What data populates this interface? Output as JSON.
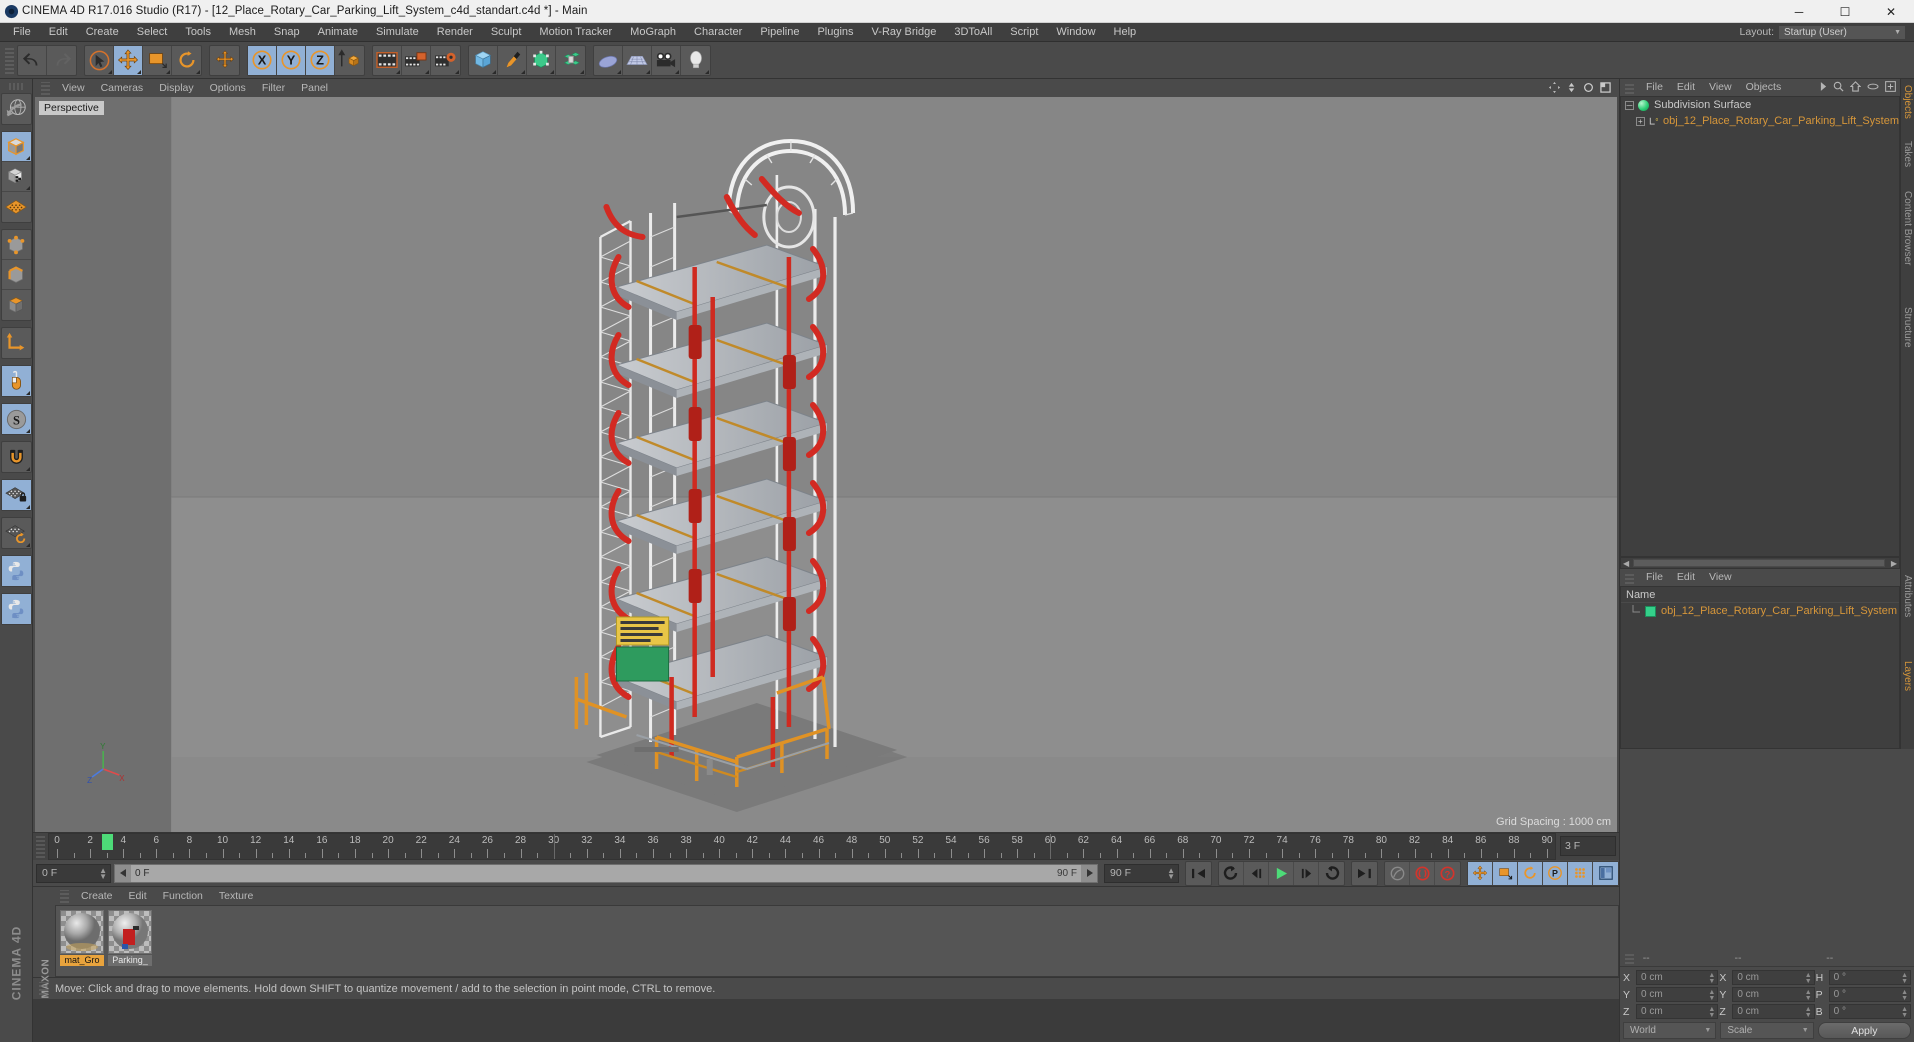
{
  "titlebar": {
    "title": "CINEMA 4D R17.016 Studio (R17) - [12_Place_Rotary_Car_Parking_Lift_System_c4d_standart.c4d *] - Main",
    "minimize": "─",
    "maximize": "☐",
    "close": "✕"
  },
  "menubar": {
    "items": [
      "File",
      "Edit",
      "Create",
      "Select",
      "Tools",
      "Mesh",
      "Snap",
      "Animate",
      "Simulate",
      "Render",
      "Sculpt",
      "Motion Tracker",
      "MoGraph",
      "Character",
      "Pipeline",
      "Plugins",
      "V-Ray Bridge",
      "3DToAll",
      "Script",
      "Window",
      "Help"
    ]
  },
  "layout": {
    "label": "Layout:",
    "value": "Startup (User)"
  },
  "toolbar": {
    "groups": [
      {
        "name": "undo-redo",
        "buttons": [
          {
            "name": "undo-icon",
            "label": "undo",
            "active": false
          },
          {
            "name": "redo-icon",
            "label": "redo",
            "active": false
          }
        ]
      },
      {
        "name": "transform-tools",
        "buttons": [
          {
            "name": "live-selection-icon",
            "label": "Live Selection",
            "active": false
          },
          {
            "name": "move-tool-icon",
            "label": "Move",
            "active": true
          },
          {
            "name": "scale-tool-icon",
            "label": "Scale",
            "active": false
          },
          {
            "name": "rotate-tool-icon",
            "label": "Rotate",
            "active": false
          }
        ]
      },
      {
        "name": "axis-lock",
        "buttons": [
          {
            "name": "world-axis-icon",
            "label": "Axis",
            "active": false
          }
        ]
      },
      {
        "name": "axis-xyz",
        "buttons": [
          {
            "name": "x-axis-icon",
            "label": "X",
            "active": true
          },
          {
            "name": "y-axis-icon",
            "label": "Y",
            "active": true
          },
          {
            "name": "z-axis-icon",
            "label": "Z",
            "active": true
          },
          {
            "name": "object-world-icon",
            "label": "World/Object",
            "active": false
          }
        ]
      },
      {
        "name": "render-group",
        "buttons": [
          {
            "name": "render-view-icon",
            "label": "Render View",
            "active": false
          },
          {
            "name": "render-region-icon",
            "label": "Render to Picture Viewer",
            "active": false
          },
          {
            "name": "render-settings-icon",
            "label": "Edit Render Settings",
            "active": false
          }
        ]
      },
      {
        "name": "create-group",
        "buttons": [
          {
            "name": "cube-primitive-icon",
            "label": "Add Cube Object",
            "active": false
          },
          {
            "name": "spline-pen-icon",
            "label": "Add Spline",
            "active": false
          },
          {
            "name": "nurbs-generator-icon",
            "label": "Add Generator",
            "active": false
          },
          {
            "name": "deformer-icon",
            "label": "Add Deformer",
            "active": false
          }
        ]
      },
      {
        "name": "scene-group",
        "buttons": [
          {
            "name": "floor-environment-icon",
            "label": "Add Environment",
            "active": false
          },
          {
            "name": "sky-icon",
            "label": "Add Sky",
            "active": false
          },
          {
            "name": "camera-icon",
            "label": "Add Camera",
            "active": false
          },
          {
            "name": "light-icon",
            "label": "Add Light",
            "active": false
          }
        ]
      }
    ]
  },
  "left_toolbar": {
    "groups": [
      {
        "buttons": [
          {
            "name": "undo-view-icon",
            "label": "Undo View",
            "active": false
          }
        ]
      },
      {
        "buttons": [
          {
            "name": "model-mode-icon",
            "label": "Model Mode",
            "active": true
          },
          {
            "name": "texture-mode-icon",
            "label": "Texture Mode",
            "active": false
          },
          {
            "name": "workplane-icon",
            "label": "Workplane",
            "active": false
          }
        ]
      },
      {
        "buttons": [
          {
            "name": "points-mode-icon",
            "label": "Points",
            "active": false
          },
          {
            "name": "edges-mode-icon",
            "label": "Edges",
            "active": false
          },
          {
            "name": "polygons-mode-icon",
            "label": "Polygons",
            "active": false
          }
        ]
      },
      {
        "buttons": [
          {
            "name": "axis-modify-icon",
            "label": "Enable Axis",
            "active": false
          }
        ]
      },
      {
        "buttons": [
          {
            "name": "viewport-solo-icon",
            "label": "Viewport Solo",
            "active": true
          }
        ]
      },
      {
        "buttons": [
          {
            "name": "snap-enable-icon",
            "label": "Enable Snap",
            "active": true
          }
        ]
      },
      {
        "buttons": [
          {
            "name": "magnet-icon",
            "label": "Magnet",
            "active": false
          }
        ]
      },
      {
        "buttons": [
          {
            "name": "workplane-lock-icon",
            "label": "Lock Workplane",
            "active": true
          }
        ]
      },
      {
        "buttons": [
          {
            "name": "workplane-align-icon",
            "label": "Align Workplane",
            "active": false
          }
        ]
      },
      {
        "buttons": [
          {
            "name": "python-script-icon",
            "label": "Python Script",
            "active": true
          }
        ]
      },
      {
        "buttons": [
          {
            "name": "python-generator-icon",
            "label": "Python Generator",
            "active": true
          }
        ]
      }
    ],
    "brand": "CINEMA 4D"
  },
  "viewport": {
    "menu": [
      "View",
      "Cameras",
      "Display",
      "Options",
      "Filter",
      "Panel"
    ],
    "label": "Perspective",
    "grid_spacing": "Grid Spacing : 1000 cm",
    "axis": {
      "x": "X",
      "y": "Y",
      "z": "Z"
    }
  },
  "timeline": {
    "start_frame": "0 F",
    "end_frame": "90 F",
    "current_frame": "0 F",
    "range_end": "90 F",
    "preview_frame": "3 F",
    "playhead_frame": 3,
    "ticks": [
      0,
      2,
      4,
      6,
      8,
      10,
      12,
      14,
      16,
      18,
      20,
      22,
      24,
      26,
      28,
      30,
      32,
      34,
      36,
      38,
      40,
      42,
      44,
      46,
      48,
      50,
      52,
      54,
      56,
      58,
      60,
      62,
      64,
      66,
      68,
      70,
      72,
      74,
      76,
      78,
      80,
      82,
      84,
      86,
      88,
      90
    ],
    "transport": [
      {
        "name": "go-to-start-button",
        "label": "|◀◀"
      },
      {
        "name": "play-backwards-button",
        "label": "↺"
      },
      {
        "name": "step-back-button",
        "label": "◀|"
      },
      {
        "name": "play-forward-button",
        "label": "▶"
      },
      {
        "name": "step-forward-button",
        "label": "|▶"
      },
      {
        "name": "play-loop-button",
        "label": "↻"
      },
      {
        "name": "go-to-end-button",
        "label": "▶▶|"
      }
    ],
    "record_tools": [
      {
        "name": "autokey-toggle-button",
        "label": "Autokeying"
      },
      {
        "name": "record-active-objects-button",
        "label": "Record Active Objects"
      },
      {
        "name": "keyframe-selection-button",
        "label": "Keyframe Selection"
      }
    ],
    "anim_tools": [
      {
        "name": "position-key-button",
        "label": "Position",
        "active": true
      },
      {
        "name": "scale-key-button",
        "label": "Scale",
        "active": true
      },
      {
        "name": "rotation-key-button",
        "label": "Rotation",
        "active": true
      },
      {
        "name": "param-key-button",
        "label": "PLA / Parameter",
        "active": true
      },
      {
        "name": "point-level-animation-button",
        "label": "Point Level Animation",
        "active": true
      },
      {
        "name": "timeline-toggle-button",
        "label": "Timeline",
        "active": true
      }
    ]
  },
  "material_manager": {
    "menu": [
      "Create",
      "Edit",
      "Function",
      "Texture"
    ],
    "materials": [
      {
        "name": "mat_Gro",
        "selected": true
      },
      {
        "name": "Parking_",
        "selected": false
      }
    ]
  },
  "statusbar": {
    "message": "Move: Click and drag to move elements. Hold down SHIFT to quantize movement / add to the selection in point mode, CTRL to remove."
  },
  "object_manager": {
    "menu": [
      "File",
      "Edit",
      "View",
      "Objects"
    ],
    "icons": [
      "chevron-right-icon",
      "search-icon",
      "home-icon",
      "ellipse-icon",
      "plus-box-icon"
    ],
    "items": [
      {
        "label": "Subdivision Surface",
        "indent": 0,
        "icon": "subdivision-surface-icon"
      },
      {
        "label": "obj_12_Place_Rotary_Car_Parking_Lift_System",
        "indent": 1,
        "icon": "null-object-icon"
      }
    ],
    "side_tabs": [
      "Objects",
      "Takes",
      "Content Browser",
      "Structure"
    ]
  },
  "layer_manager": {
    "menu": [
      "File",
      "Edit",
      "View"
    ],
    "column_header": "Name",
    "items": [
      {
        "label": "obj_12_Place_Rotary_Car_Parking_Lift_System",
        "color": "#34d08a"
      }
    ],
    "side_tabs": [
      "Attributes",
      "Layers"
    ]
  },
  "coordinates": {
    "headers": [
      "--",
      "--",
      "--"
    ],
    "rows": [
      {
        "label1": "X",
        "value1": "0 cm",
        "label2": "X",
        "value2": "0 cm",
        "label3": "H",
        "value3": "0 °"
      },
      {
        "label1": "Y",
        "value1": "0 cm",
        "label2": "Y",
        "value2": "0 cm",
        "label3": "P",
        "value3": "0 °"
      },
      {
        "label1": "Z",
        "value1": "0 cm",
        "label2": "Z",
        "value2": "0 cm",
        "label3": "B",
        "value3": "0 °"
      }
    ],
    "coord_system": "World",
    "size_mode": "Scale",
    "apply": "Apply"
  },
  "colors": {
    "accent_orange": "#e8952a",
    "panel_bg": "#4a4a4a",
    "field_bg": "#3f3f3f",
    "active_blue": "#91b0d5",
    "viewport_bg": "#7d7d7d"
  }
}
